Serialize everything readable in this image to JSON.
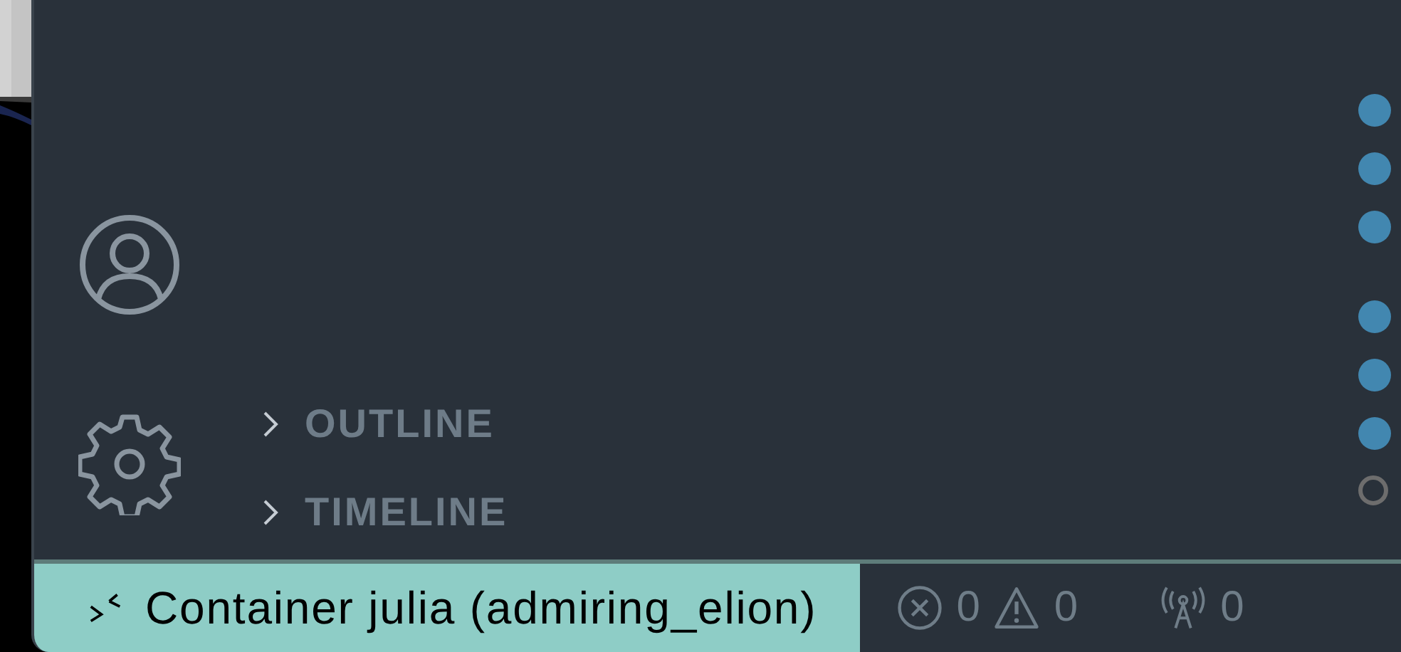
{
  "sidebar": {
    "sections": [
      {
        "title": "OUTLINE",
        "expanded": false
      },
      {
        "title": "TIMELINE",
        "expanded": false
      }
    ]
  },
  "markers": [
    {
      "dots": [
        {
          "filled": true
        },
        {
          "filled": true
        },
        {
          "filled": true
        }
      ]
    },
    {
      "dots": [
        {
          "filled": true
        },
        {
          "filled": true
        },
        {
          "filled": true
        },
        {
          "filled": false
        }
      ]
    }
  ],
  "status_bar": {
    "remote": "Container julia (admiring_elion)",
    "errors": "0",
    "warnings": "0",
    "ports": "0"
  }
}
